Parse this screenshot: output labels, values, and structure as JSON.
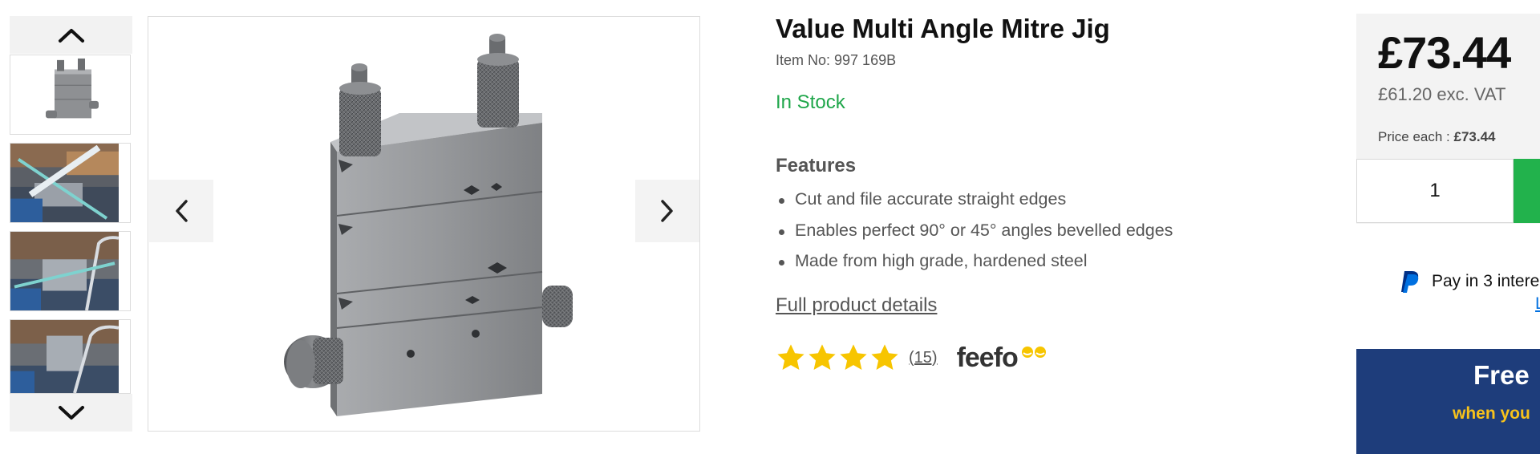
{
  "product": {
    "title": "Value Multi Angle Mitre Jig",
    "item_no": "Item No: 997 169B",
    "stock_status": "In Stock",
    "features_title": "Features",
    "features": [
      "Cut and file accurate straight edges",
      "Enables perfect 90° or 45° angles bevelled edges",
      "Made from high grade, hardened steel"
    ],
    "details_link": "Full product details"
  },
  "rating": {
    "stars": 4,
    "review_count": "(15)",
    "provider": "feefo"
  },
  "gallery": {
    "thumbnails": [
      {
        "name": "mitre-jig-product"
      },
      {
        "name": "jig-filing-in-use"
      },
      {
        "name": "jig-sawing-in-use"
      },
      {
        "name": "jig-in-vice"
      }
    ],
    "icons": {
      "up": "chevron-up-icon",
      "down": "chevron-down-icon",
      "prev": "chevron-left-icon",
      "next": "chevron-right-icon"
    }
  },
  "buy_box": {
    "price": "£73.44",
    "price_ex_vat": "£61.20 exc. VAT",
    "price_each_label": "Price each : ",
    "price_each_value": "£73.44",
    "quantity": "1"
  },
  "paypal": {
    "text": "Pay in 3 intere",
    "link": "L"
  },
  "delivery_banner": {
    "title": "Free",
    "subtitle": "when you"
  },
  "colors": {
    "in_stock": "#1fa64a",
    "star": "#f7c500",
    "add_button": "#22b24c",
    "banner_bg": "#1e3d7b",
    "banner_sub": "#f7c21b",
    "link_blue": "#0070e0"
  }
}
